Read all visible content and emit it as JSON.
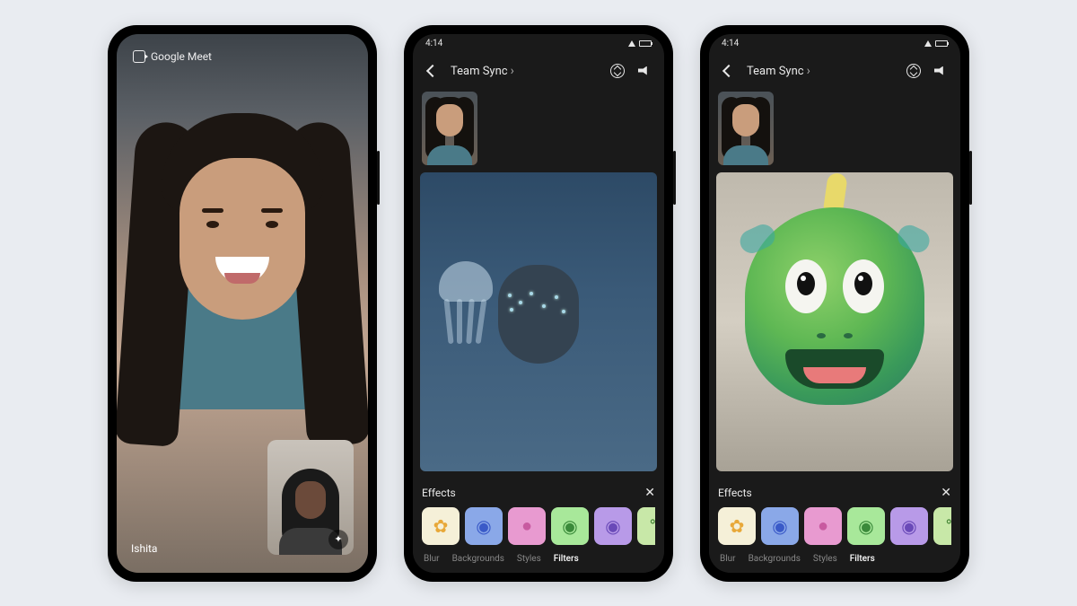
{
  "phone1": {
    "brand": "Google Meet",
    "caller_name": "Ishita"
  },
  "phone2": {
    "status_time": "4:14",
    "call_title": "Team Sync",
    "effects_label": "Effects",
    "tabs": {
      "blur": "Blur",
      "backgrounds": "Backgrounds",
      "styles": "Styles",
      "filters": "Filters"
    }
  },
  "phone3": {
    "status_time": "4:14",
    "call_title": "Team Sync",
    "effects_label": "Effects",
    "tabs": {
      "blur": "Blur",
      "backgrounds": "Backgrounds",
      "styles": "Styles",
      "filters": "Filters"
    }
  },
  "filter_tiles": [
    {
      "name": "flower",
      "bg": "#f5f0d8",
      "glyph": "✿",
      "fg": "#e8a838"
    },
    {
      "name": "blue-bot",
      "bg": "#8aa8e8",
      "glyph": "◉",
      "fg": "#3a5ac8"
    },
    {
      "name": "pink-blob",
      "bg": "#e89ad0",
      "glyph": "●",
      "fg": "#c85aa0"
    },
    {
      "name": "green-eye",
      "bg": "#a8e89a",
      "glyph": "◉",
      "fg": "#3a8a3a"
    },
    {
      "name": "purple-bot",
      "bg": "#b89ae8",
      "glyph": "◉",
      "fg": "#6a4ab8"
    },
    {
      "name": "frog",
      "bg": "#c8e8a8",
      "glyph": "°°",
      "fg": "#4a8a3a"
    }
  ]
}
